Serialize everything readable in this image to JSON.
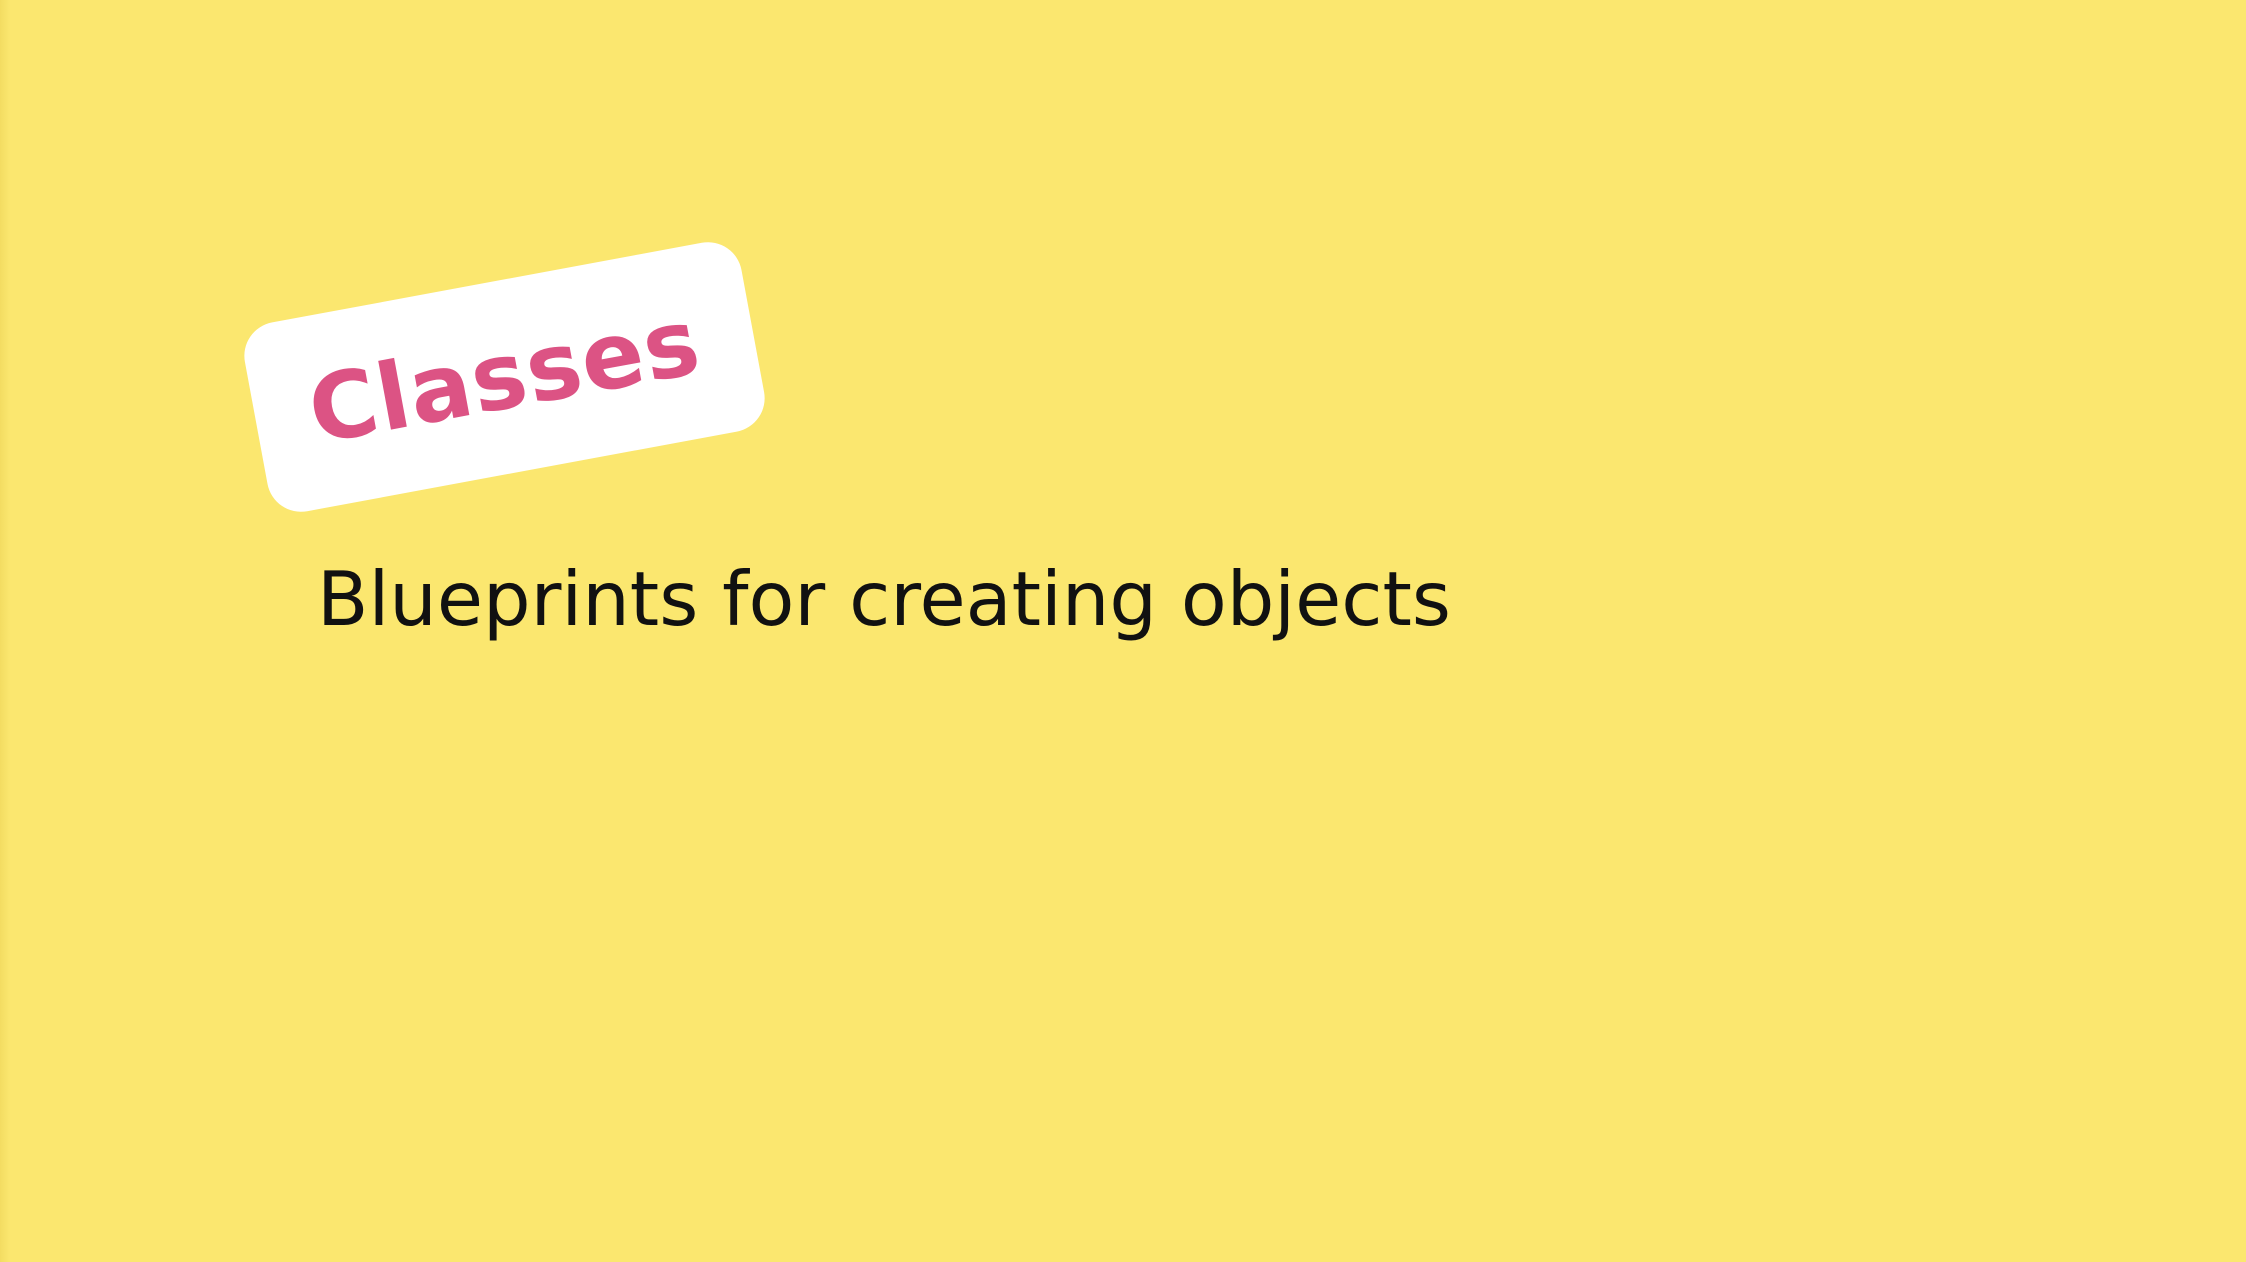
{
  "slide": {
    "title": "Classes",
    "subtitle": "Blueprints for creating objects"
  },
  "colors": {
    "background": "#fbe76f",
    "tag_background": "#ffffff",
    "title_text": "#dc5384",
    "subtitle_text": "#111111"
  }
}
